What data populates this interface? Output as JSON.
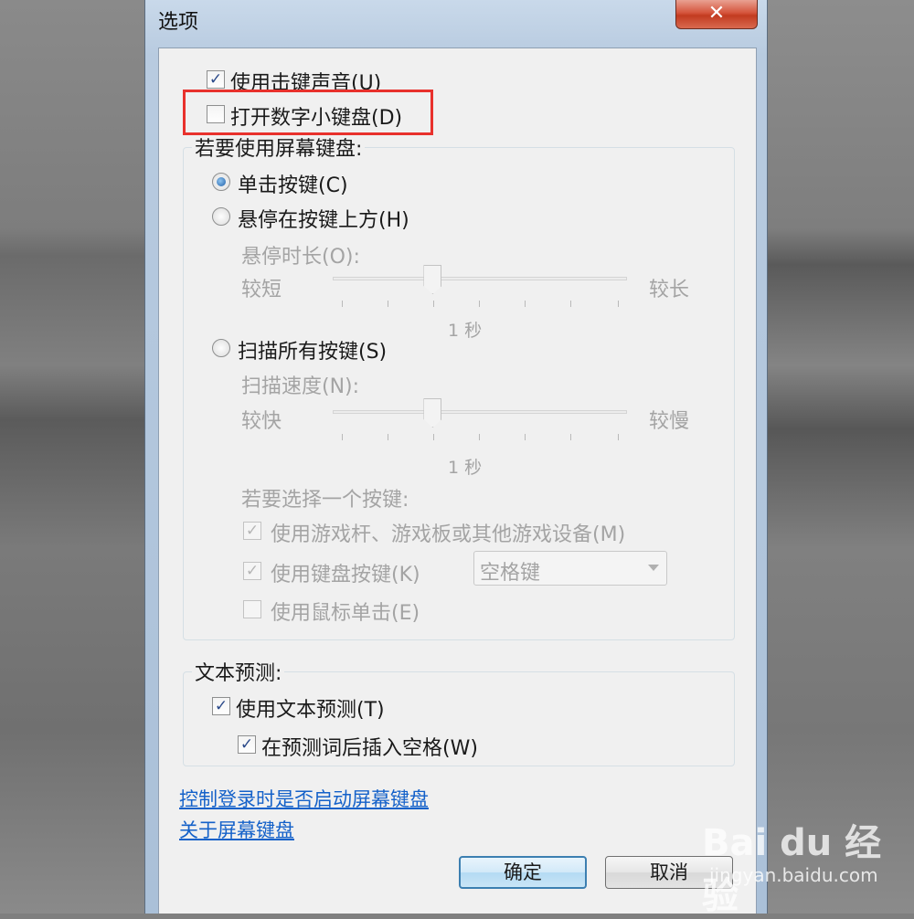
{
  "window": {
    "title": "选项",
    "close_glyph": "✕"
  },
  "options": {
    "key_sound": {
      "label": "使用击键声音(U)",
      "checked": true
    },
    "num_pad": {
      "label": "打开数字小键盘(D)",
      "checked": false
    }
  },
  "onscreen_group": {
    "title": "若要使用屏幕键盘:",
    "click_keys": {
      "label": "单击按键(C)",
      "selected": true
    },
    "hover_keys": {
      "label": "悬停在按键上方(H)",
      "selected": false
    },
    "hover_duration": {
      "label": "悬停时长(O):",
      "min_label": "较短",
      "max_label": "较长",
      "value_label": "1 秒",
      "value_fraction": 0.34
    },
    "scan_keys": {
      "label": "扫描所有按键(S)",
      "selected": false
    },
    "scan_speed": {
      "label": "扫描速度(N):",
      "min_label": "较快",
      "max_label": "较慢",
      "value_label": "1 秒",
      "value_fraction": 0.34
    },
    "select_key_prompt": "若要选择一个按键:",
    "joystick": {
      "label": "使用游戏杆、游戏板或其他游戏设备(M)",
      "checked": true
    },
    "keyboard_key": {
      "label": "使用键盘按键(K)",
      "checked": true
    },
    "key_select": {
      "value": "空格键"
    },
    "mouse_click": {
      "label": "使用鼠标单击(E)",
      "checked": false
    }
  },
  "text_prediction_group": {
    "title": "文本预测:",
    "use_prediction": {
      "label": "使用文本预测(T)",
      "checked": true
    },
    "insert_space": {
      "label": "在预测词后插入空格(W)",
      "checked": true
    }
  },
  "links": {
    "login_control": "控制登录时是否启动屏幕键盘",
    "about": "关于屏幕键盘"
  },
  "buttons": {
    "ok": "确定",
    "cancel": "取消"
  },
  "watermark": {
    "brand": "Bai du 经验",
    "url": "jingyan.baidu.com"
  },
  "colors": {
    "highlight": "#e8312c",
    "link": "#1461c9",
    "accent": "#3c7fb1"
  }
}
